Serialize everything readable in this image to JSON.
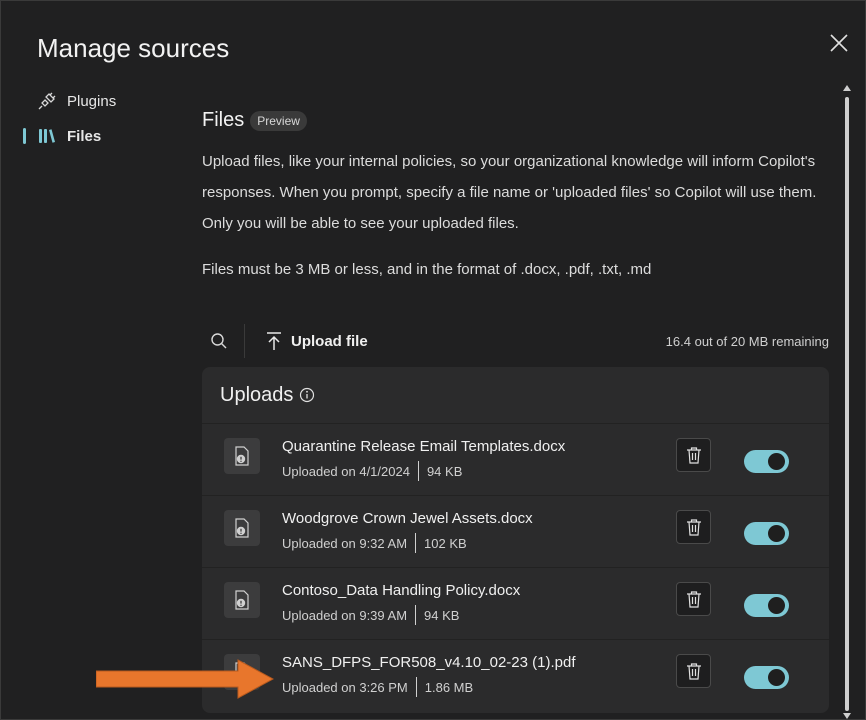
{
  "dialog": {
    "title": "Manage sources"
  },
  "nav": {
    "items": [
      {
        "label": "Plugins",
        "icon": "plug-icon",
        "active": false
      },
      {
        "label": "Files",
        "icon": "library-icon",
        "active": true
      }
    ]
  },
  "files": {
    "title": "Files",
    "badge": "Preview",
    "description": "Upload files, like your internal policies, so your organizational knowledge will inform Copilot's responses. When you prompt, specify a file name or 'uploaded files' so Copilot will use them. Only you will be able to see your uploaded files.",
    "limits": "Files must be 3 MB or less, and in the format of .docx, .pdf, .txt, .md"
  },
  "toolbar": {
    "upload_label": "Upload file",
    "remaining": "16.4 out of 20 MB remaining"
  },
  "uploads": {
    "title": "Uploads",
    "rows": [
      {
        "name": "Quarantine Release Email Templates.docx",
        "uploaded": "Uploaded on 4/1/2024",
        "size": "94 KB",
        "enabled": true
      },
      {
        "name": "Woodgrove Crown Jewel Assets.docx",
        "uploaded": "Uploaded on 9:32 AM",
        "size": "102 KB",
        "enabled": true
      },
      {
        "name": "Contoso_Data Handling Policy.docx",
        "uploaded": "Uploaded on 9:39 AM",
        "size": "94 KB",
        "enabled": true
      },
      {
        "name": "SANS_DFPS_FOR508_v4.10_02-23 (1).pdf",
        "uploaded": "Uploaded on 3:26 PM",
        "size": "1.86 MB",
        "enabled": true
      }
    ]
  },
  "colors": {
    "accent": "#7ec8d4",
    "annotation_arrow": "#e8762c"
  }
}
